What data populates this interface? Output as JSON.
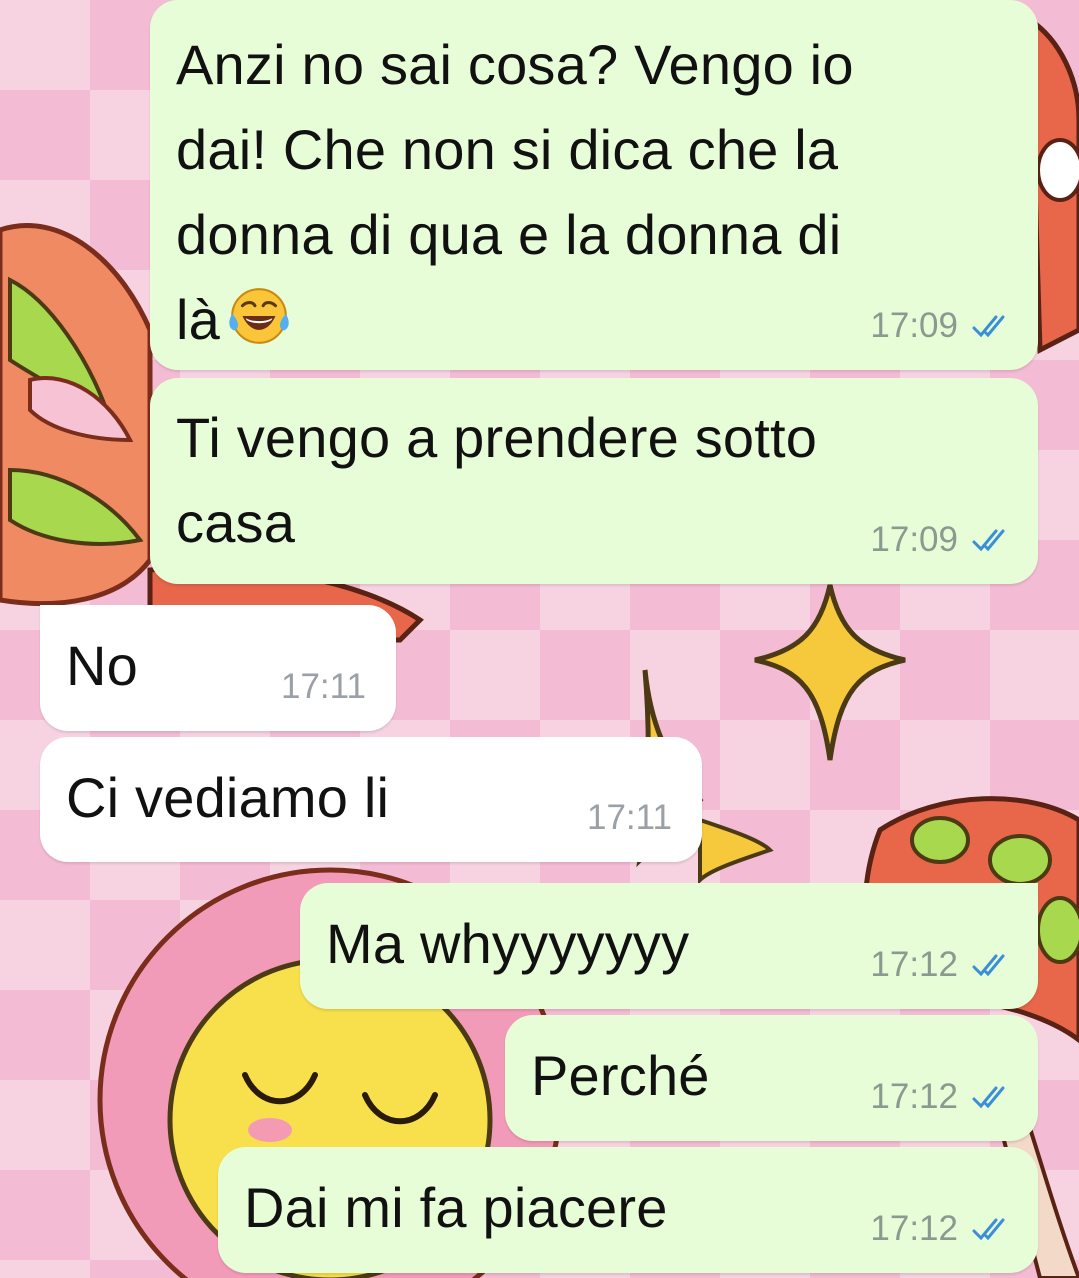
{
  "theme": {
    "outgoing_bubble": "#e7fdd8",
    "incoming_bubble": "#ffffff",
    "read_tick": "#3b8fd6",
    "wallpaper_pink": "#f7d3e2"
  },
  "messages": [
    {
      "direction": "outgoing",
      "lines": [
        "Anzi no sai cosa? Vengo io",
        "dai! Che non si dica che la",
        "donna di qua e la donna di",
        "là"
      ],
      "emoji": "face-with-tears-of-joy",
      "time": "17:09",
      "status": "read"
    },
    {
      "direction": "outgoing",
      "lines": [
        "Ti vengo a prendere sotto",
        "casa"
      ],
      "time": "17:09",
      "status": "read"
    },
    {
      "direction": "incoming",
      "lines": [
        "No"
      ],
      "time": "17:11"
    },
    {
      "direction": "incoming",
      "lines": [
        "Ci vediamo li"
      ],
      "time": "17:11"
    },
    {
      "direction": "outgoing",
      "lines": [
        "Ma whyyyyyyy"
      ],
      "time": "17:12",
      "status": "read"
    },
    {
      "direction": "outgoing",
      "lines": [
        "Perché"
      ],
      "time": "17:12",
      "status": "read"
    },
    {
      "direction": "outgoing",
      "lines": [
        "Dai mi fa piacere"
      ],
      "time": "17:12",
      "status": "read"
    }
  ]
}
